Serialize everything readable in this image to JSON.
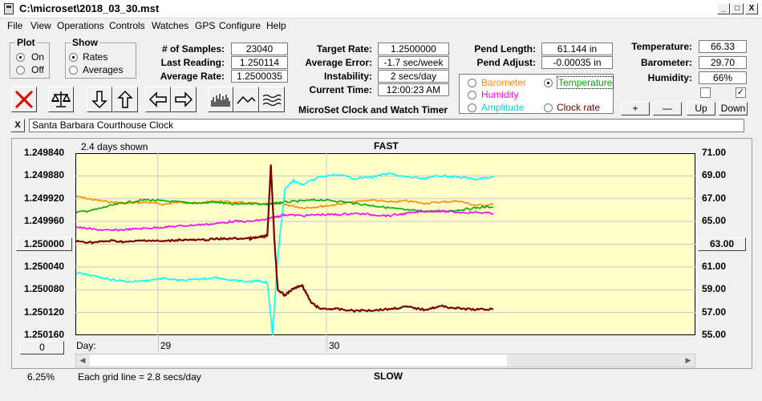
{
  "window": {
    "title": "C:\\microset\\2018_03_30.mst",
    "min": "_",
    "max": "□",
    "close": "X"
  },
  "menu": [
    "File",
    "View",
    "Operations",
    "Controls",
    "Watches",
    "GPS",
    "Configure",
    "Help"
  ],
  "plot_group": {
    "title": "Plot",
    "on": "On",
    "off": "Off",
    "selected": "On"
  },
  "show_group": {
    "title": "Show",
    "rates": "Rates",
    "averages": "Averages",
    "selected": "Rates"
  },
  "stats": {
    "samples_label": "# of Samples:",
    "samples": "23040",
    "last_label": "Last Reading:",
    "last": "1.250114",
    "avg_label": "Average Rate:",
    "avg": "1.2500035",
    "target_label": "Target Rate:",
    "target": "1.2500000",
    "averr_label": "Average Error:",
    "averr": "-1.7 sec/week",
    "inst_label": "Instability:",
    "inst": "2 secs/day",
    "time_label": "Current Time:",
    "time": "12:00:23 AM",
    "plen_label": "Pend Length:",
    "plen": "61.144 in",
    "padj_label": "Pend Adjust:",
    "padj": "-0.00035 in",
    "temp_label": "Temperature:",
    "temp": "66.33",
    "baro_label": "Barometer:",
    "baro": "29.70",
    "hum_label": "Humidity:",
    "hum": "66%"
  },
  "app_caption": "MicroSet Clock and Watch Timer",
  "series_select": {
    "barometer": "Barometer",
    "temperature": "Temperature",
    "humidity": "Humidity",
    "amplitude": "Amplitude",
    "clockrate": "Clock rate",
    "selected": "Temperature"
  },
  "adjust_buttons": {
    "plus": "+",
    "minus": "—",
    "up": "Up",
    "down": "Down"
  },
  "clock_name": "Santa Barbara Courthouse Clock",
  "close_small": "X",
  "graph": {
    "days_shown": "2.4 days shown",
    "fast": "FAST",
    "slow": "SLOW",
    "grid_note": "Each grid line = 2.8 secs/day",
    "day_label": "Day:",
    "left_button": "1.250000",
    "right_button": "63.00",
    "bottom_button": "0",
    "percent": "6.25%"
  },
  "colors": {
    "plot_bg": "#ffffc8",
    "barometer": "#ff8c00",
    "temperature": "#00aa00",
    "humidity": "#ff00ff",
    "amplitude": "#00ffff",
    "clockrate": "#7a0000",
    "stop_red": "#e00000"
  },
  "chart_data": {
    "type": "line",
    "left_axis_ticks": [
      "1.249840",
      "1.249880",
      "1.249920",
      "1.249960",
      "1.250000",
      "1.250040",
      "1.250080",
      "1.250120",
      "1.250160"
    ],
    "right_axis_ticks": [
      "71.00",
      "69.00",
      "67.00",
      "65.00",
      "63.00",
      "61.00",
      "59.00",
      "57.00",
      "55.00"
    ],
    "x_ticks": [
      "29",
      "30"
    ],
    "ylim_left": [
      1.24984,
      1.25016
    ],
    "ylim_right": [
      55,
      71
    ],
    "left_inverted": true,
    "grid": true,
    "series": [
      {
        "key": "barometer",
        "axis": "right",
        "x": [
          0,
          0.1,
          0.2,
          0.3,
          0.4,
          0.5,
          0.6,
          0.7,
          0.8,
          0.9,
          1.0,
          1.1,
          1.15,
          1.2,
          1.3,
          1.4,
          1.5,
          1.6,
          1.7,
          1.8,
          1.9,
          2.0,
          2.1,
          2.2,
          2.3,
          2.4
        ],
        "y": [
          67.2,
          66.9,
          66.7,
          66.6,
          66.7,
          66.5,
          66.7,
          66.6,
          66.8,
          66.7,
          66.6,
          66.5,
          66.6,
          66.5,
          66.2,
          66.3,
          66.5,
          66.7,
          66.9,
          66.7,
          66.8,
          66.6,
          66.7,
          66.8,
          66.4,
          66.5
        ]
      },
      {
        "key": "temperature",
        "axis": "right",
        "x": [
          0,
          0.1,
          0.2,
          0.3,
          0.4,
          0.5,
          0.6,
          0.7,
          0.8,
          0.9,
          1.0,
          1.1,
          1.15,
          1.2,
          1.3,
          1.4,
          1.5,
          1.6,
          1.7,
          1.8,
          1.9,
          2.0,
          2.1,
          2.2,
          2.3,
          2.4
        ],
        "y": [
          65.8,
          66.0,
          66.4,
          66.7,
          66.9,
          66.8,
          66.7,
          66.6,
          66.7,
          66.5,
          66.6,
          66.5,
          66.6,
          66.7,
          66.8,
          66.9,
          66.8,
          66.6,
          66.4,
          66.2,
          66.0,
          65.9,
          65.9,
          66.0,
          66.2,
          66.3
        ]
      },
      {
        "key": "humidity",
        "axis": "right",
        "x": [
          0,
          0.1,
          0.2,
          0.3,
          0.4,
          0.5,
          0.6,
          0.7,
          0.8,
          0.9,
          1.0,
          1.1,
          1.15,
          1.2,
          1.3,
          1.4,
          1.5,
          1.6,
          1.7,
          1.8,
          1.9,
          2.0,
          2.1,
          2.2,
          2.3,
          2.4
        ],
        "y": [
          64.5,
          64.3,
          64.2,
          64.3,
          64.4,
          64.5,
          64.6,
          64.7,
          64.8,
          65.0,
          65.0,
          65.2,
          65.4,
          65.6,
          65.5,
          65.6,
          65.6,
          65.7,
          65.6,
          65.5,
          65.7,
          65.9,
          65.9,
          65.8,
          65.8,
          65.7
        ]
      },
      {
        "key": "amplitude",
        "axis": "right",
        "x": [
          0,
          0.1,
          0.2,
          0.3,
          0.4,
          0.5,
          0.6,
          0.7,
          0.8,
          0.9,
          1.0,
          1.05,
          1.1,
          1.13,
          1.16,
          1.2,
          1.25,
          1.3,
          1.4,
          1.5,
          1.6,
          1.7,
          1.8,
          1.9,
          2.0,
          2.1,
          2.2,
          2.3,
          2.4
        ],
        "y": [
          60.5,
          60.2,
          59.9,
          59.7,
          59.8,
          60.0,
          59.8,
          59.9,
          60.1,
          59.8,
          59.7,
          59.8,
          59.6,
          55.0,
          62.0,
          67.8,
          68.6,
          68.2,
          68.9,
          69.1,
          68.8,
          68.9,
          69.2,
          68.9,
          68.8,
          69.0,
          68.9,
          68.7,
          68.9
        ]
      },
      {
        "key": "clockrate",
        "axis": "left",
        "x": [
          0,
          0.1,
          0.2,
          0.3,
          0.4,
          0.5,
          0.6,
          0.7,
          0.8,
          0.9,
          1.0,
          1.05,
          1.1,
          1.12,
          1.14,
          1.16,
          1.2,
          1.25,
          1.3,
          1.35,
          1.4,
          1.5,
          1.6,
          1.7,
          1.8,
          1.9,
          2.0,
          2.1,
          2.2,
          2.3,
          2.4
        ],
        "y": [
          1.249995,
          1.249997,
          1.249994,
          1.249996,
          1.249993,
          1.249995,
          1.249992,
          1.249993,
          1.249991,
          1.24999,
          1.24999,
          1.249988,
          1.249985,
          1.24986,
          1.24999,
          1.25008,
          1.25009,
          1.250078,
          1.250072,
          1.250102,
          1.250113,
          1.250114,
          1.250117,
          1.250116,
          1.250114,
          1.25011,
          1.250115,
          1.250109,
          1.250113,
          1.250115,
          1.250114
        ]
      }
    ]
  }
}
